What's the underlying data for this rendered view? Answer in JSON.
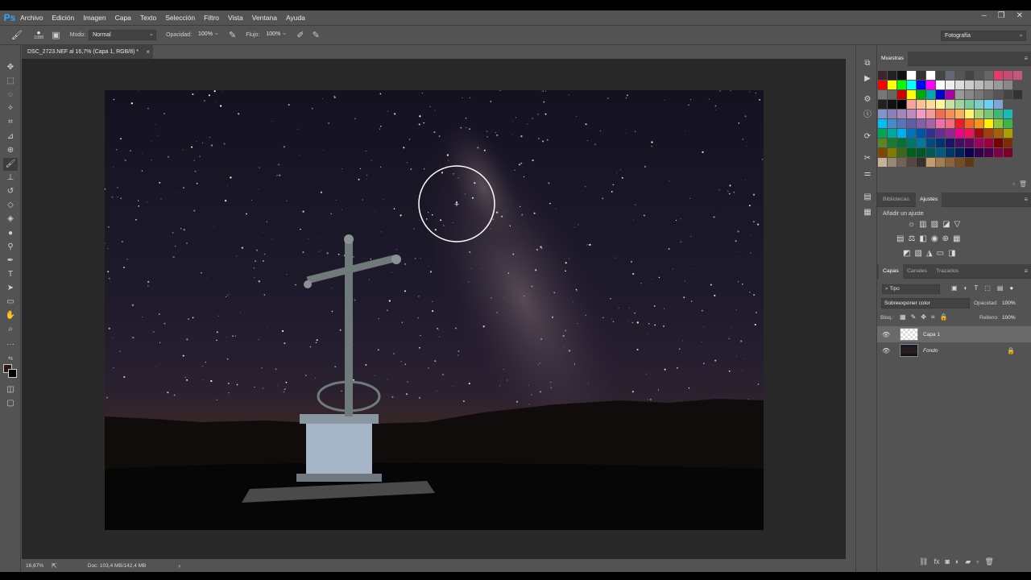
{
  "app": {
    "logo": "Ps"
  },
  "menu": [
    "Archivo",
    "Edición",
    "Imagen",
    "Capa",
    "Texto",
    "Selección",
    "Filtro",
    "Vista",
    "Ventana",
    "Ayuda"
  ],
  "options": {
    "brush_size": "1088",
    "mode_label": "Modo:",
    "mode_value": "Normal",
    "opacity_label": "Opacidad:",
    "opacity_value": "100%",
    "flow_label": "Flujo:",
    "flow_value": "100%",
    "workspace": "Fotografía"
  },
  "document": {
    "tab_title": "DSC_2723.NEF al 16,7% (Capa 1, RGB/8) *",
    "close": "×"
  },
  "status": {
    "zoom": "16,67%",
    "doc_info": "Doc: 103,4 MB/142,4 MB"
  },
  "panels": {
    "swatches_title": "Muestras",
    "tab_libraries": "Bibliotecas",
    "tab_adjustments": "Ajustes",
    "adjust_add": "Añadir un ajuste",
    "tab_layers": "Capas",
    "tab_channels": "Canales",
    "tab_paths": "Trazados",
    "filter_kind": "Tipo",
    "blend_mode": "Sobreexponer color",
    "opacity_label": "Opacidad:",
    "opacity_value": "100%",
    "lock_label": "Bloq.:",
    "fill_label": "Relleno:",
    "fill_value": "100%",
    "layers": [
      {
        "name": "Capa 1"
      },
      {
        "name": "Fondo"
      }
    ]
  },
  "colors": {
    "accent": "#31a8ff",
    "foreground": "#2a1a16",
    "background": "#000000"
  }
}
